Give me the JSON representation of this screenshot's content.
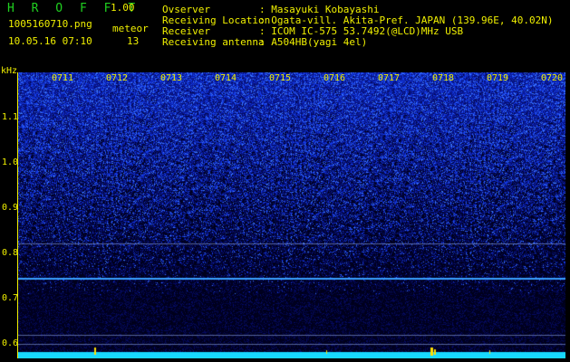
{
  "header": {
    "app_title": "H R O F F T",
    "version": "1.00",
    "file_name": "1005160710.png",
    "meteor_label": "meteor",
    "datetime": "10.05.16 07:10",
    "meteor_count": "13"
  },
  "info": {
    "observer_label": "Ovserver",
    "observer_value": ": Masayuki Kobayashi",
    "location_label": "Receiving Location",
    "location_value": ": Ogata-vill. Akita-Pref. JAPAN (139.96E, 40.02N)",
    "receiver_label": "Receiver",
    "receiver_value": ": ICOM IC-575 53.7492(@LCD)MHz USB",
    "antenna_label": "Receiving antenna",
    "antenna_value": ": A504HB(yagi 4el)"
  },
  "spectrogram": {
    "y_unit": "kHz",
    "y_ticks": [
      "1.1",
      "1.0",
      "0.9",
      "0.8",
      "0.7",
      "0.6"
    ],
    "x_ticks": [
      "0711",
      "0712",
      "0713",
      "0714",
      "0715",
      "0716",
      "0717",
      "0718",
      "0719",
      "0720"
    ],
    "colors": {
      "background": "#000000",
      "noise_high": "#1a4dff",
      "noise_mid": "#0d1fa8",
      "carrier_line": "#3aa0ff",
      "bottom_band": "#18d8ff",
      "text_green": "#20d020",
      "text_yellow": "#f0f000"
    }
  }
}
